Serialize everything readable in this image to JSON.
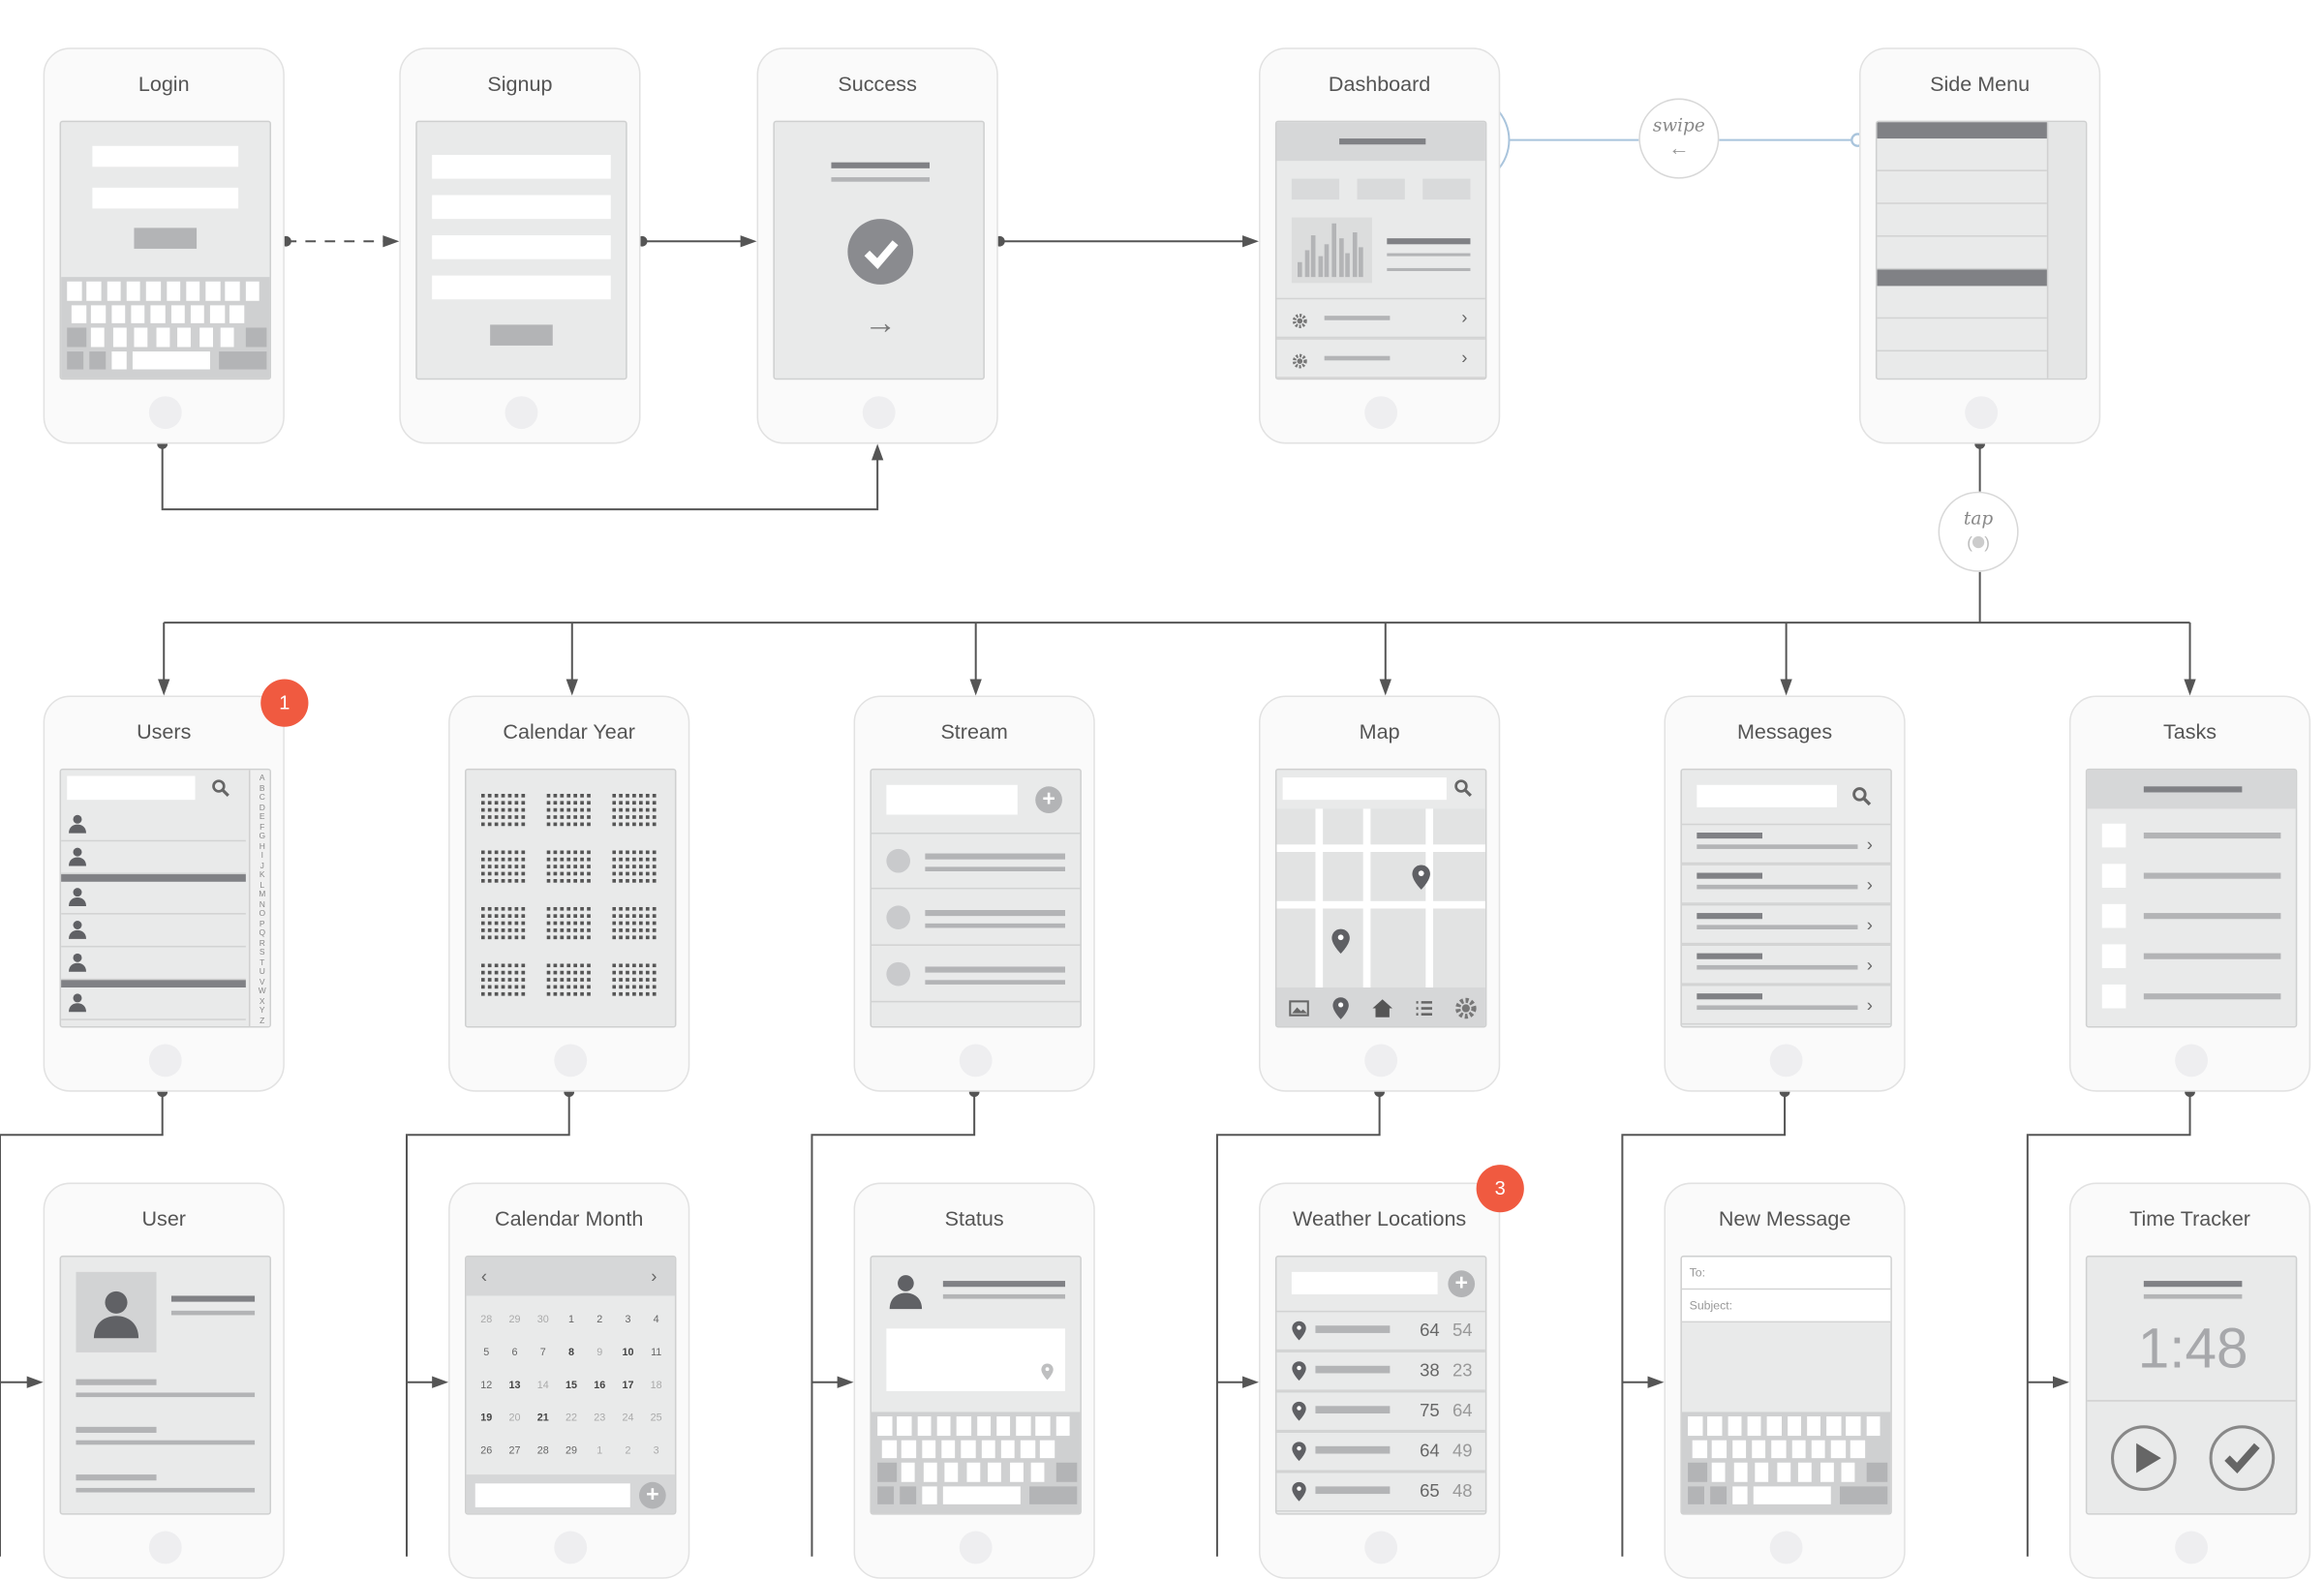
{
  "colors": {
    "badge": "#f05a40",
    "gesture_line": "#a9c4dc",
    "connector": "#555555"
  },
  "gestures": {
    "swipe": "swipe",
    "tap": "tap"
  },
  "badges": [
    "1",
    "3"
  ],
  "phones": [
    {
      "id": "login",
      "title": "Login",
      "type": "login"
    },
    {
      "id": "signup",
      "title": "Signup",
      "type": "signup"
    },
    {
      "id": "success",
      "title": "Success",
      "type": "success"
    },
    {
      "id": "dashboard",
      "title": "Dashboard",
      "type": "dashboard"
    },
    {
      "id": "side-menu",
      "title": "Side Menu",
      "type": "sidemenu"
    },
    {
      "id": "users",
      "title": "Users",
      "type": "users",
      "alphabet": "ABCDEFGHIJKLMNOPQRSTUVWXYZ"
    },
    {
      "id": "calendar-year",
      "title": "Calendar Year",
      "type": "calyear"
    },
    {
      "id": "stream",
      "title": "Stream",
      "type": "stream"
    },
    {
      "id": "map",
      "title": "Map",
      "type": "map"
    },
    {
      "id": "messages",
      "title": "Messages",
      "type": "messages"
    },
    {
      "id": "tasks",
      "title": "Tasks",
      "type": "tasks"
    },
    {
      "id": "user",
      "title": "User",
      "type": "user"
    },
    {
      "id": "calendar-month",
      "title": "Calendar Month",
      "type": "calmonth",
      "days": [
        [
          "28",
          "m"
        ],
        [
          "29",
          "m"
        ],
        [
          "30",
          "m"
        ],
        [
          "1",
          "n"
        ],
        [
          "2",
          "n"
        ],
        [
          "3",
          "n"
        ],
        [
          "4",
          "n"
        ],
        [
          "5",
          "n"
        ],
        [
          "6",
          "n"
        ],
        [
          "7",
          "n"
        ],
        [
          "8",
          "b"
        ],
        [
          "9",
          "m"
        ],
        [
          "10",
          "b"
        ],
        [
          "11",
          "n"
        ],
        [
          "12",
          "n"
        ],
        [
          "13",
          "b"
        ],
        [
          "14",
          "m"
        ],
        [
          "15",
          "b"
        ],
        [
          "16",
          "b"
        ],
        [
          "17",
          "b"
        ],
        [
          "18",
          "m"
        ],
        [
          "19",
          "b"
        ],
        [
          "20",
          "m"
        ],
        [
          "21",
          "b"
        ],
        [
          "22",
          "m"
        ],
        [
          "23",
          "m"
        ],
        [
          "24",
          "m"
        ],
        [
          "25",
          "m"
        ],
        [
          "26",
          "n"
        ],
        [
          "27",
          "n"
        ],
        [
          "28",
          "n"
        ],
        [
          "29",
          "n"
        ],
        [
          "1",
          "m"
        ],
        [
          "2",
          "m"
        ],
        [
          "3",
          "m"
        ]
      ]
    },
    {
      "id": "status",
      "title": "Status",
      "type": "status"
    },
    {
      "id": "weather-locations",
      "title": "Weather Locations",
      "type": "weather",
      "temps": [
        [
          "64",
          "54"
        ],
        [
          "38",
          "23"
        ],
        [
          "75",
          "64"
        ],
        [
          "64",
          "49"
        ],
        [
          "65",
          "48"
        ]
      ]
    },
    {
      "id": "new-message",
      "title": "New Message",
      "type": "newmsg",
      "to_label": "To:",
      "subject_label": "Subject:"
    },
    {
      "id": "time-tracker",
      "title": "Time Tracker",
      "type": "timer",
      "time": "1:48"
    }
  ]
}
